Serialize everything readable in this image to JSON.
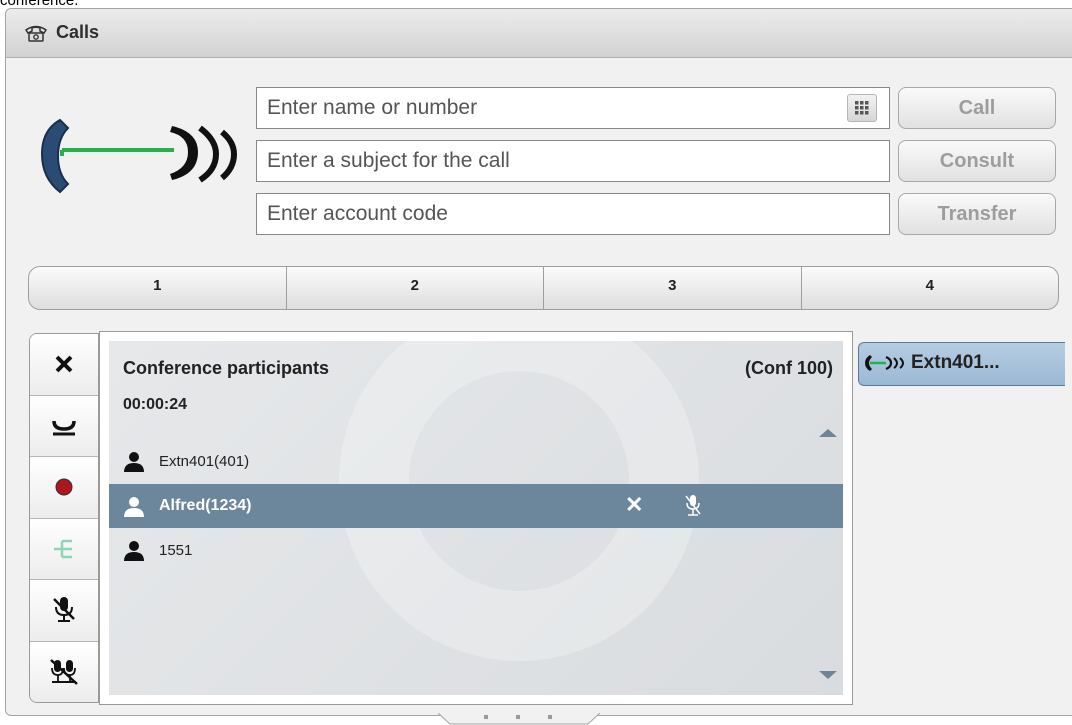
{
  "page_fragment_top": "conference.",
  "window": {
    "title": "Calls",
    "title_icon": "phone-icon"
  },
  "inputs": {
    "name_placeholder": "Enter name or number",
    "subject_placeholder": "Enter a subject for the call",
    "account_placeholder": "Enter account code"
  },
  "buttons": {
    "call": "Call",
    "consult": "Consult",
    "transfer": "Transfer"
  },
  "tabs": [
    {
      "label": "1"
    },
    {
      "label": "2"
    },
    {
      "label": "3"
    },
    {
      "label": "4"
    }
  ],
  "side_toolbar": [
    {
      "icon": "close-icon"
    },
    {
      "icon": "hangup-icon"
    },
    {
      "icon": "record-icon"
    },
    {
      "icon": "conference-split-icon"
    },
    {
      "icon": "mute-mic-icon"
    },
    {
      "icon": "mute-all-icon"
    }
  ],
  "conference": {
    "title": "Conference participants",
    "conf_id": "(Conf 100)",
    "timer": "00:00:24",
    "participants": [
      {
        "name": "Extn401(401)",
        "selected": false
      },
      {
        "name": "Alfred(1234)",
        "selected": true
      },
      {
        "name": "1551",
        "selected": false
      }
    ]
  },
  "call_chip": {
    "label": "Extn401...",
    "icon": "active-call-icon"
  },
  "colors": {
    "selected_row": "#6c869c",
    "call_line": "#22b14c",
    "record": "#b0141c",
    "chip_bg": "#a9c3dc"
  }
}
